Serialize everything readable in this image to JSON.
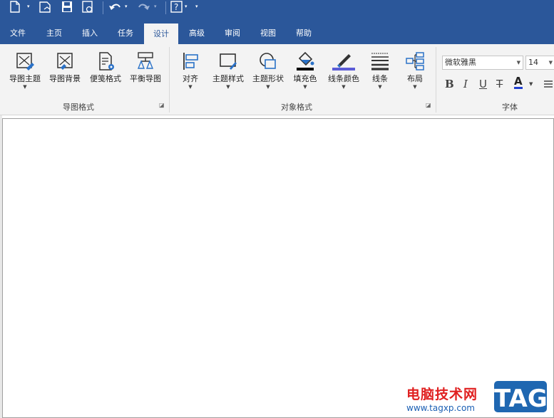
{
  "tabs": [
    {
      "label": "文件"
    },
    {
      "label": "主页"
    },
    {
      "label": "插入"
    },
    {
      "label": "任务"
    },
    {
      "label": "设计"
    },
    {
      "label": "高级"
    },
    {
      "label": "审阅"
    },
    {
      "label": "视图"
    },
    {
      "label": "帮助"
    }
  ],
  "groups": {
    "map_format": {
      "label": "导图格式",
      "buttons": [
        {
          "label": "导图主题"
        },
        {
          "label": "导图背景"
        },
        {
          "label": "便笺格式"
        },
        {
          "label": "平衡导图"
        }
      ]
    },
    "object_format": {
      "label": "对象格式",
      "buttons": [
        {
          "label": "对齐"
        },
        {
          "label": "主题样式"
        },
        {
          "label": "主题形状"
        },
        {
          "label": "填充色"
        },
        {
          "label": "线条颜色"
        },
        {
          "label": "线条"
        },
        {
          "label": "布局"
        }
      ]
    },
    "font": {
      "label": "字体",
      "font_name": "微软雅黑",
      "font_size": "14",
      "bold": "B",
      "italic": "I",
      "underline": "U",
      "strike": "T",
      "color": "A"
    }
  },
  "colors": {
    "accent": "#2b579a",
    "fill_bar": "#000000",
    "line_color_bar": "#5b5bd6",
    "font_color_bar": "#1f3fd0"
  },
  "watermark": {
    "text": "电脑技术网",
    "url": "www.tagxp.com",
    "logo": "TAG"
  }
}
